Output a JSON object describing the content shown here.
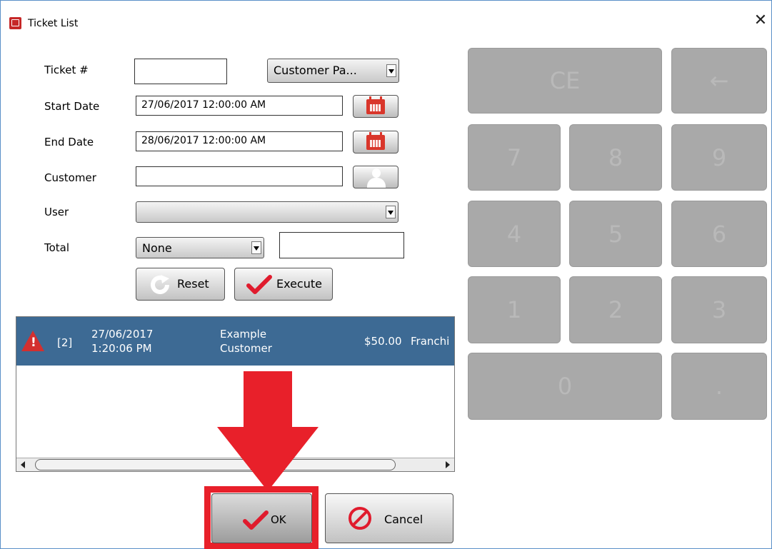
{
  "window": {
    "title": "Ticket List",
    "close_symbol": "✕"
  },
  "form": {
    "ticket_label": "Ticket #",
    "ticket_value": "",
    "type_combo": "Customer Pa...",
    "start_label": "Start Date",
    "start_value": "27/06/2017 12:00:00 AM",
    "end_label": "End Date",
    "end_value": "28/06/2017 12:00:00 AM",
    "customer_label": "Customer",
    "customer_value": "",
    "user_label": "User",
    "user_value": "",
    "total_label": "Total",
    "total_combo": "None",
    "total_value": "",
    "reset_label": "Reset",
    "execute_label": "Execute"
  },
  "list": {
    "rows": [
      {
        "id": "[2]",
        "date": "27/06/2017",
        "time": "1:20:06 PM",
        "customer_line1": "Example",
        "customer_line2": "Customer",
        "amount": "$50.00",
        "extra": "Franchi"
      }
    ]
  },
  "keypad": {
    "keys": [
      "CE",
      "←",
      "7",
      "8",
      "9",
      "4",
      "5",
      "6",
      "1",
      "2",
      "3",
      "0",
      "."
    ]
  },
  "footer": {
    "ok_label": "OK",
    "cancel_label": "Cancel"
  },
  "colors": {
    "highlight": "#e8202a",
    "row_bg": "#3d6a94",
    "key_bg": "#a9a9a9",
    "warning": "#d32f2f"
  }
}
